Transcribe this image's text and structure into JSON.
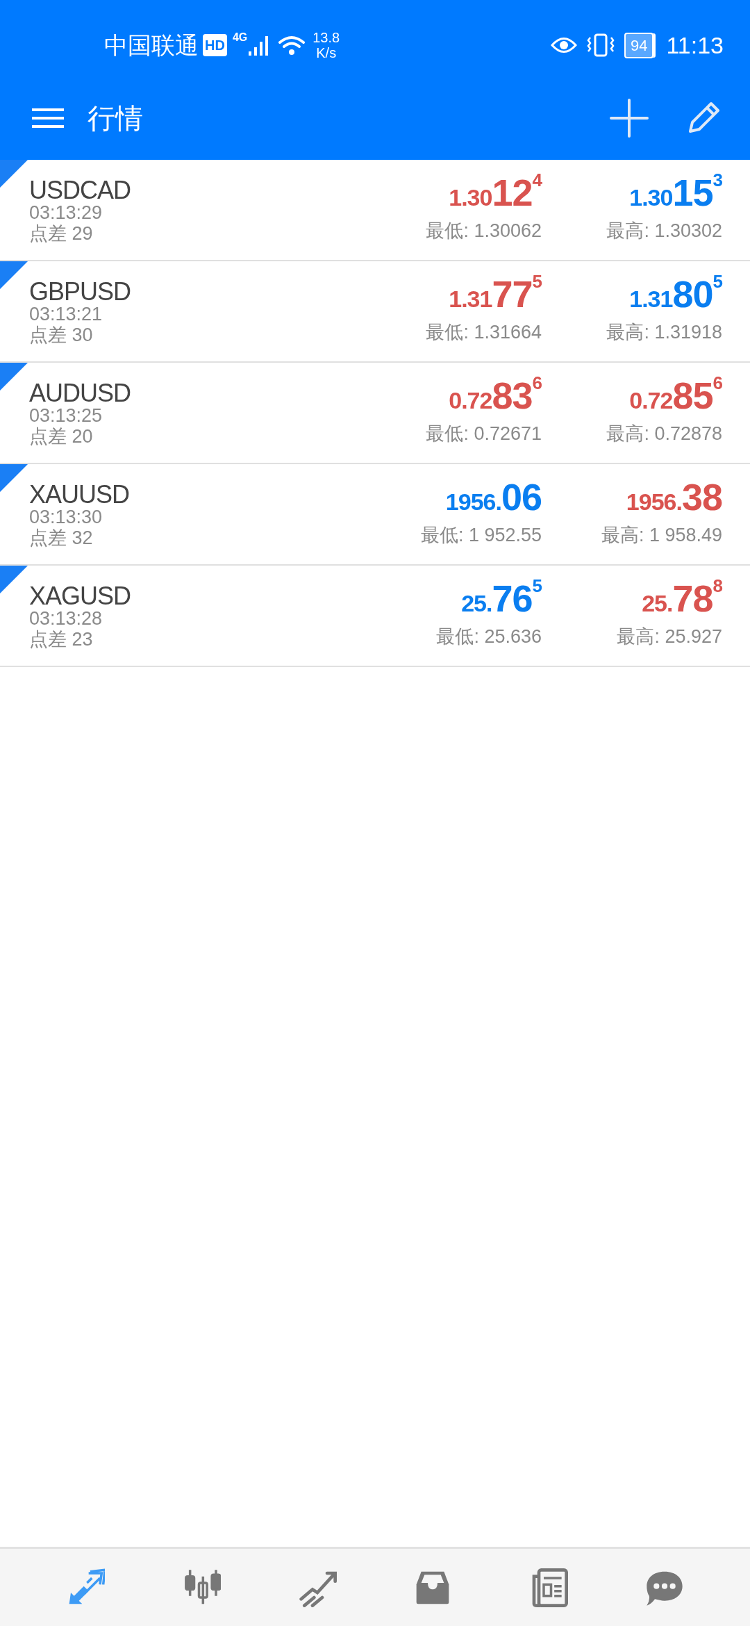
{
  "status_bar": {
    "carrier": "中国联通",
    "hd": "HD",
    "network": "4G",
    "speed_value": "13.8",
    "speed_unit": "K/s",
    "battery": "94",
    "time": "11:13"
  },
  "toolbar": {
    "title": "行情"
  },
  "quotes": [
    {
      "symbol": "USDCAD",
      "time": "03:13:29",
      "spread": "点差 29",
      "bid": {
        "prefix": "1.30",
        "big": "12",
        "sup": "4",
        "color": "#d9534f"
      },
      "ask": {
        "prefix": "1.30",
        "big": "15",
        "sup": "3",
        "color": "#0a7ef0"
      },
      "low": "最低: 1.30062",
      "high": "最高: 1.30302"
    },
    {
      "symbol": "GBPUSD",
      "time": "03:13:21",
      "spread": "点差 30",
      "bid": {
        "prefix": "1.31",
        "big": "77",
        "sup": "5",
        "color": "#d9534f"
      },
      "ask": {
        "prefix": "1.31",
        "big": "80",
        "sup": "5",
        "color": "#0a7ef0"
      },
      "low": "最低: 1.31664",
      "high": "最高: 1.31918"
    },
    {
      "symbol": "AUDUSD",
      "time": "03:13:25",
      "spread": "点差 20",
      "bid": {
        "prefix": "0.72",
        "big": "83",
        "sup": "6",
        "color": "#d9534f"
      },
      "ask": {
        "prefix": "0.72",
        "big": "85",
        "sup": "6",
        "color": "#d9534f"
      },
      "low": "最低: 0.72671",
      "high": "最高: 0.72878"
    },
    {
      "symbol": "XAUUSD",
      "time": "03:13:30",
      "spread": "点差 32",
      "bid": {
        "prefix": "1956.",
        "big": "06",
        "color": "#0a7ef0"
      },
      "ask": {
        "prefix": "1956.",
        "big": "38",
        "color": "#d9534f"
      },
      "low": "最低: 1 952.55",
      "high": "最高: 1 958.49"
    },
    {
      "symbol": "XAGUSD",
      "time": "03:13:28",
      "spread": "点差 23",
      "bid": {
        "prefix": "25.",
        "big": "76",
        "sup": "5",
        "color": "#0a7ef0"
      },
      "ask": {
        "prefix": "25.",
        "big": "78",
        "sup": "8",
        "color": "#d9534f"
      },
      "low": "最低: 25.636",
      "high": "最高: 25.927"
    }
  ],
  "bottom_nav": [
    {
      "kind": "quotes",
      "selected": true
    },
    {
      "kind": "chart",
      "selected": false
    },
    {
      "kind": "trade",
      "selected": false
    },
    {
      "kind": "history",
      "selected": false
    },
    {
      "kind": "news",
      "selected": false
    },
    {
      "kind": "chat",
      "selected": false
    }
  ]
}
